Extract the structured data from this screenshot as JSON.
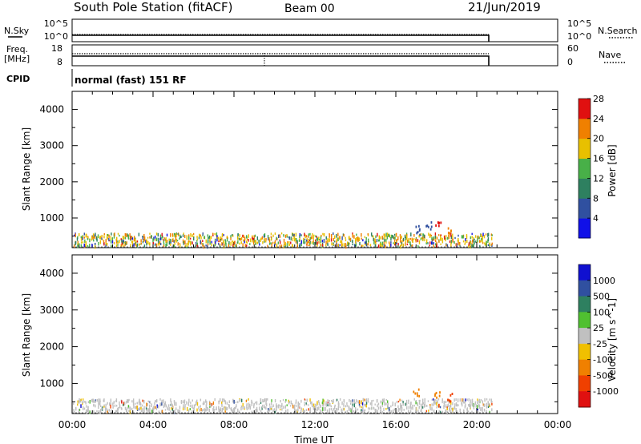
{
  "header": {
    "station": "South Pole Station (fitACF)",
    "beam": "Beam 00",
    "date": "21/Jun/2019"
  },
  "panels": {
    "noise": {
      "left_label": "N.Sky",
      "left_tick_top": "10^5",
      "left_tick_bottom": "10^0",
      "right_tick_top": "10^5",
      "right_tick_bottom": "10^0",
      "right_label": "N.Search"
    },
    "freq": {
      "left_label_1": "Freq.",
      "left_label_2": "[MHz]",
      "left_tick_top": "18",
      "left_tick_bottom": "8",
      "right_tick_top": "60",
      "right_tick_bottom": "0",
      "right_label": "Nave"
    },
    "cpid": {
      "label": "CPID",
      "text": "normal (fast) 151 RF"
    }
  },
  "chart_data": [
    {
      "type": "scatter",
      "title": "",
      "xlabel": "",
      "ylabel": "Slant Range [km]",
      "xlim": [
        0,
        24
      ],
      "ylim": [
        180,
        4500
      ],
      "yticks": [
        "1000",
        "2000",
        "3000",
        "4000"
      ],
      "grid": false,
      "color_scale": {
        "label": "Power [dB]",
        "tick_labels": [
          "4",
          "8",
          "12",
          "16",
          "20",
          "24",
          "28"
        ],
        "colors": [
          "#1010e8",
          "#3050a0",
          "#2e8060",
          "#48b048",
          "#e8c000",
          "#f08000",
          "#e01010"
        ]
      },
      "data_description": {
        "main_band_km": [
          250,
          600
        ],
        "data_end_hour": 20.7,
        "echo_clusters": [
          {
            "hour": 17.0,
            "range_km": 700,
            "level": 1
          },
          {
            "hour": 17.6,
            "range_km": 820,
            "level": 1
          },
          {
            "hour": 18.1,
            "range_km": 900,
            "level": 6
          },
          {
            "hour": 18.6,
            "range_km": 640,
            "level": 5
          }
        ]
      }
    },
    {
      "type": "scatter",
      "title": "",
      "xlabel": "Time UT",
      "ylabel": "Slant Range [km]",
      "xlim": [
        0,
        24
      ],
      "ylim": [
        180,
        4500
      ],
      "xticks": [
        "00:00",
        "04:00",
        "08:00",
        "12:00",
        "16:00",
        "20:00",
        "00:00"
      ],
      "yticks": [
        "1000",
        "2000",
        "3000",
        "4000"
      ],
      "grid": false,
      "color_scale": {
        "label": "Velocity [m s^-1]",
        "tick_labels": [
          "1000",
          "500",
          "100",
          "25",
          "-25",
          "-100",
          "-500",
          "-1000"
        ],
        "colors": [
          "#1010d0",
          "#3050a0",
          "#2e8060",
          "#50c030",
          "#c0c0c0",
          "#f0c000",
          "#f08000",
          "#f04000",
          "#e01010"
        ]
      },
      "data_description": {
        "main_band_km": [
          250,
          600
        ],
        "data_end_hour": 20.7,
        "echo_clusters": [
          {
            "hour": 17.0,
            "range_km": 760,
            "level": 6
          },
          {
            "hour": 18.0,
            "range_km": 700,
            "level": 6
          },
          {
            "hour": 18.6,
            "range_km": 640,
            "level": 7
          }
        ]
      }
    }
  ]
}
